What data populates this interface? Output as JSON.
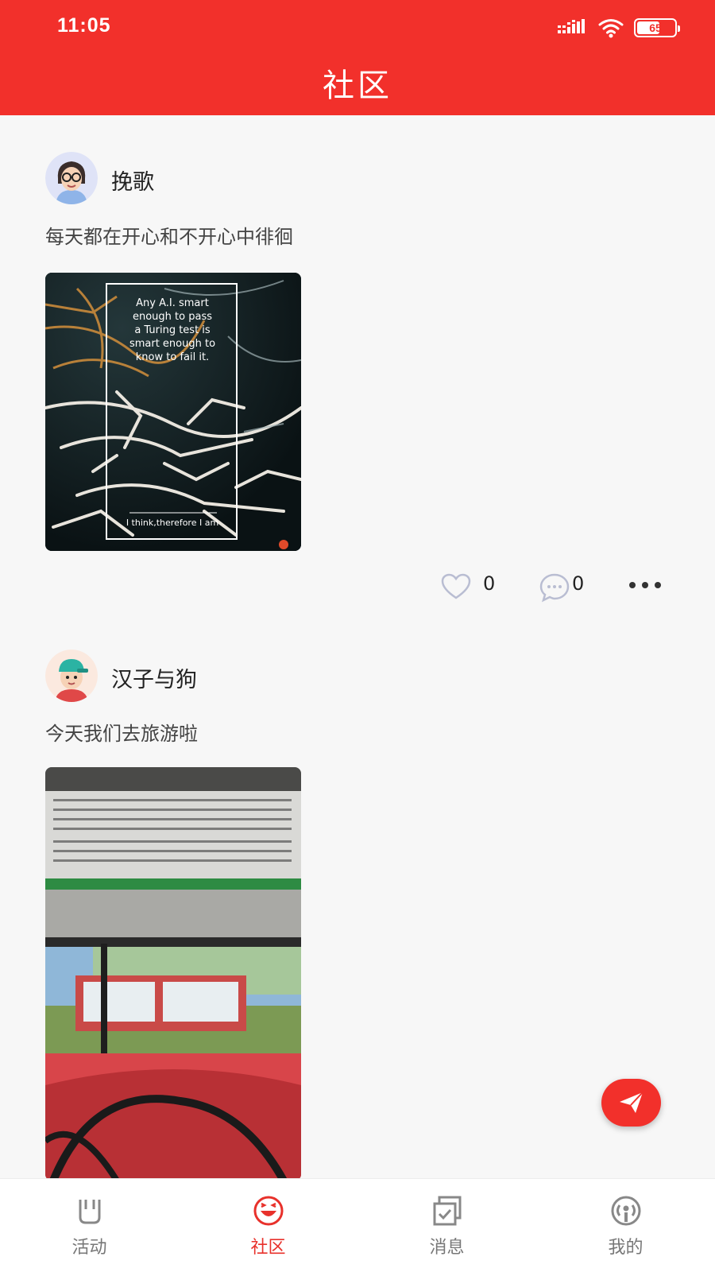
{
  "status_bar": {
    "time": "11:05",
    "battery": "65"
  },
  "header": {
    "title": "社区"
  },
  "posts": [
    {
      "username": "挽歌",
      "text": "每天都在开心和不开心中徘徊",
      "image": {
        "caption_lines": [
          "Any A.I. smart",
          "enough to pass",
          "a Turing test is",
          "smart enough to",
          "know to fail it."
        ],
        "footer": "I think,therefore I am"
      },
      "likes": "0",
      "comments": "0"
    },
    {
      "username": "汉子与狗",
      "text": "今天我们去旅游啦"
    }
  ],
  "icons": {
    "like": "heart-outline-icon",
    "comment": "chat-bubble-icon",
    "more": "more-dots-icon",
    "send": "paper-plane-icon"
  },
  "tabs": [
    {
      "label": "活动",
      "icon": "activity-icon"
    },
    {
      "label": "社区",
      "icon": "community-smile-icon",
      "active": true
    },
    {
      "label": "消息",
      "icon": "message-icon"
    },
    {
      "label": "我的",
      "icon": "profile-broadcast-icon"
    }
  ],
  "colors": {
    "brand": "#f2302b",
    "background": "#f7f7f7",
    "tab_inactive": "#777777"
  }
}
